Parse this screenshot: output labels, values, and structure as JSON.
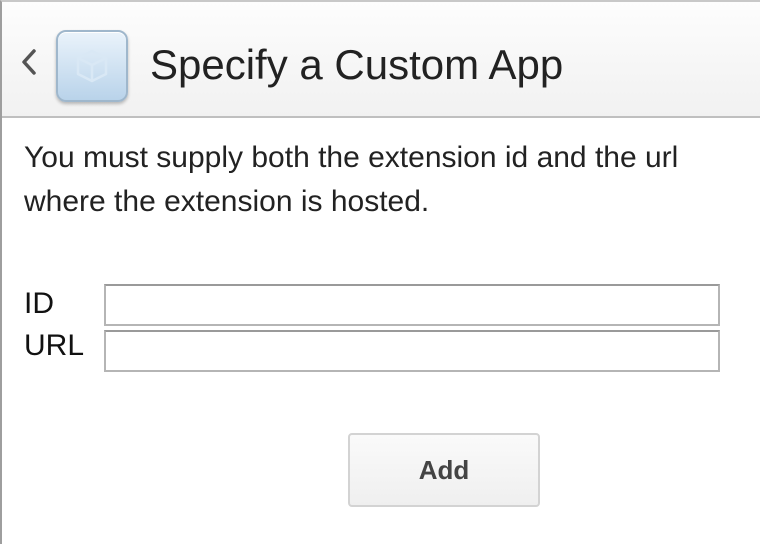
{
  "header": {
    "back_icon": "chevron-left-icon",
    "app_icon": "app-cube-icon",
    "title": "Specify a Custom App"
  },
  "main": {
    "description": "You must supply both the extension id and the url where the extension is hosted.",
    "fields": {
      "id_label": "ID",
      "id_value": "",
      "url_label": "URL",
      "url_value": ""
    },
    "add_label": "Add"
  },
  "colors": {
    "header_border": "#bfbfbf",
    "text": "#222222",
    "button_text": "#444444",
    "icon_tile": "#b9d3ea"
  }
}
